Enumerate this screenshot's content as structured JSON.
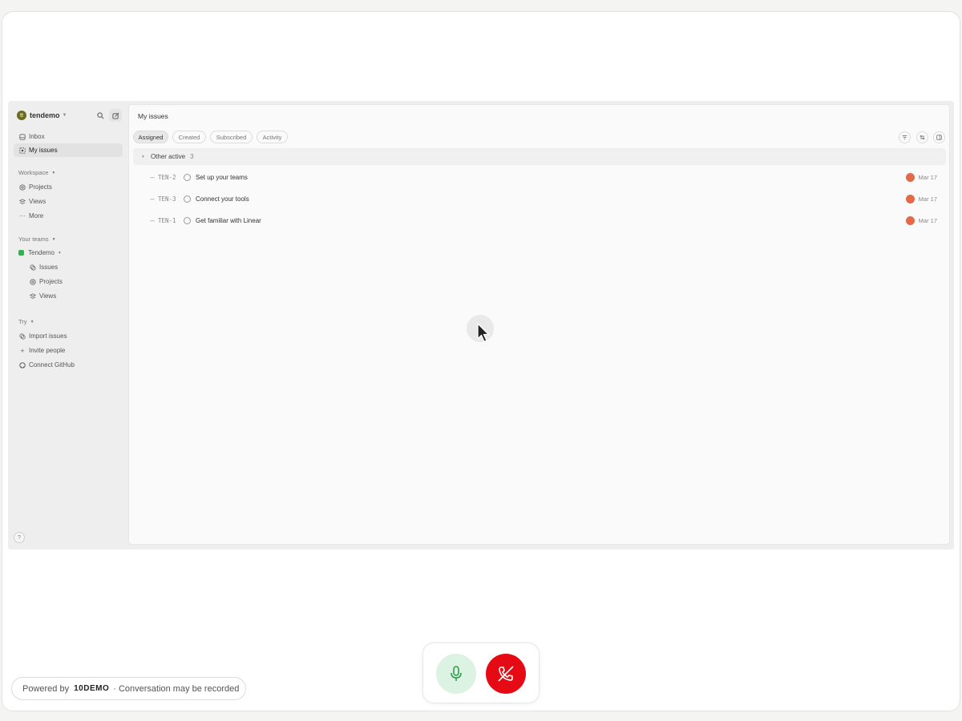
{
  "workspace": {
    "avatar_letter": "tt",
    "name": "tendemo"
  },
  "sidebar": {
    "primary": [
      {
        "label": "Inbox",
        "icon": "inbox-icon"
      },
      {
        "label": "My issues",
        "icon": "my-issues-icon",
        "active": true
      }
    ],
    "workspace_section": {
      "label": "Workspace",
      "items": [
        {
          "label": "Projects",
          "icon": "projects-icon"
        },
        {
          "label": "Views",
          "icon": "views-icon"
        },
        {
          "label": "More",
          "icon": "more-icon"
        }
      ]
    },
    "teams_section": {
      "label": "Your teams",
      "team": {
        "name": "Tendemo",
        "color": "#2fb24f"
      },
      "items": [
        {
          "label": "Issues",
          "icon": "issues-icon"
        },
        {
          "label": "Projects",
          "icon": "projects-icon"
        },
        {
          "label": "Views",
          "icon": "views-icon"
        }
      ]
    },
    "try_section": {
      "label": "Try",
      "items": [
        {
          "label": "Import issues",
          "icon": "import-icon"
        },
        {
          "label": "Invite people",
          "icon": "plus-icon"
        },
        {
          "label": "Connect GitHub",
          "icon": "github-icon"
        }
      ]
    },
    "help_label": "?"
  },
  "main": {
    "title": "My issues",
    "tabs": [
      {
        "label": "Assigned",
        "active": true
      },
      {
        "label": "Created"
      },
      {
        "label": "Subscribed"
      },
      {
        "label": "Activity"
      }
    ],
    "group": {
      "label": "Other active",
      "count": "3"
    },
    "issues": [
      {
        "id": "TEN-2",
        "title": "Set up your teams",
        "date": "Mar 17"
      },
      {
        "id": "TEN-3",
        "title": "Connect your tools",
        "date": "Mar 17"
      },
      {
        "id": "TEN-1",
        "title": "Get familiar with Linear",
        "date": "Mar 17"
      }
    ]
  },
  "footer": {
    "powered_prefix": "Powered by",
    "brand": "10DEMO",
    "suffix": "· Conversation may be recorded"
  },
  "colors": {
    "accent_green": "#2fb24f",
    "hangup_red": "#e50a14",
    "mic_bg": "#dcf2e2"
  }
}
